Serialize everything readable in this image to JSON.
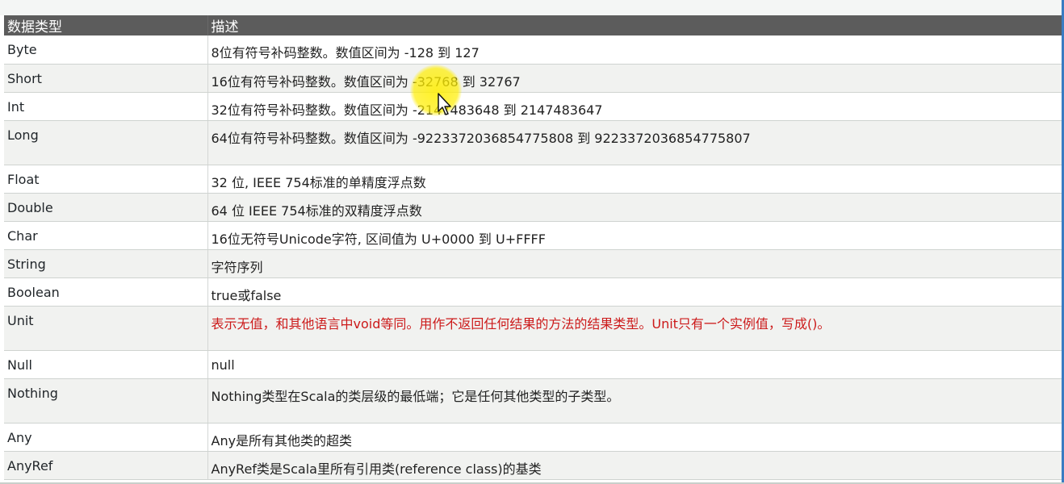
{
  "table": {
    "headers": {
      "type": "数据类型",
      "description": "描述"
    },
    "rows": [
      {
        "type": "Byte",
        "description": "8位有符号补码整数。数值区间为 -128 到 127",
        "highlight": false
      },
      {
        "type": "Short",
        "description": "16位有符号补码整数。数值区间为 -32768 到 32767",
        "highlight": false
      },
      {
        "type": "Int",
        "description": "32位有符号补码整数。数值区间为 -2147483648 到 2147483647",
        "highlight": false
      },
      {
        "type": "Long",
        "description": "64位有符号补码整数。数值区间为 -9223372036854775808 到 9223372036854775807",
        "highlight": false
      },
      {
        "type": "Float",
        "description": "32 位, IEEE 754标准的单精度浮点数",
        "highlight": false
      },
      {
        "type": "Double",
        "description": "64 位 IEEE 754标准的双精度浮点数",
        "highlight": false
      },
      {
        "type": "Char",
        "description": "16位无符号Unicode字符, 区间值为 U+0000 到 U+FFFF",
        "highlight": false
      },
      {
        "type": "String",
        "description": "字符序列",
        "highlight": false
      },
      {
        "type": "Boolean",
        "description": "true或false",
        "highlight": false
      },
      {
        "type": "Unit",
        "description": "表示无值，和其他语言中void等同。用作不返回任何结果的方法的结果类型。Unit只有一个实例值，写成()。",
        "highlight": true
      },
      {
        "type": "Null",
        "description": "null",
        "highlight": false
      },
      {
        "type": "Nothing",
        "description": "Nothing类型在Scala的类层级的最低端；它是任何其他类型的子类型。",
        "highlight": false
      },
      {
        "type": "Any",
        "description": "Any是所有其他类的超类",
        "highlight": false
      },
      {
        "type": "AnyRef",
        "description": "AnyRef类是Scala里所有引用类(reference class)的基类",
        "highlight": false
      }
    ]
  },
  "cursor": {
    "icon": "mouse-pointer-icon",
    "highlight_color": "#ffee00"
  },
  "colors": {
    "header_bg": "#5c5c5c",
    "header_text": "#ffffff",
    "row_alt_bg": "#f1f2f0",
    "highlight_text": "#cc1a1a"
  }
}
